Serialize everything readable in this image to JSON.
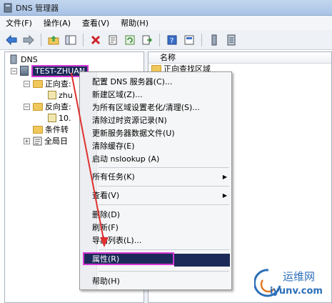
{
  "window": {
    "title": "DNS 管理器"
  },
  "menubar": {
    "items": [
      "文件(F)",
      "操作(A)",
      "查看(V)",
      "帮助(H)"
    ]
  },
  "toolbar": {
    "icons": [
      "back-arrow-icon",
      "forward-arrow-icon",
      "up-folder-icon",
      "show-hide-tree-icon",
      "delete-icon",
      "properties-icon",
      "refresh-icon",
      "export-icon",
      "help-icon",
      "console-icon",
      "server-list-icon",
      "server-icon"
    ]
  },
  "tree": {
    "root": "DNS",
    "server": "TEST-ZHUAN",
    "forward_zone": "正向查:",
    "forward_child": "zhu",
    "reverse_zone": "反向查:",
    "reverse_child": "10.",
    "conditional": "条件转",
    "global_logs": "全局日"
  },
  "list": {
    "column_header": "名称",
    "rows": [
      "正向查找区域"
    ]
  },
  "context_menu": {
    "items": [
      "配置 DNS 服务器(C)...",
      "新建区域(Z)...",
      "为所有区域设置老化/清理(S)...",
      "清除过时资源记录(N)",
      "更新服务器数据文件(U)",
      "清除缓存(E)",
      "启动 nslookup (A)",
      "所有任务(K)",
      "查看(V)",
      "删除(D)",
      "刷新(F)",
      "导出列表(L)...",
      "属性(R)",
      "帮助(H)"
    ]
  },
  "watermark": {
    "line1": "运维网",
    "line2": "iyunv.com"
  },
  "colors": {
    "highlight_border": "#d63ad6",
    "selection_bg": "#1c2a59",
    "annotation_arrow": "#e03030",
    "watermark": "#2c6fb8"
  }
}
